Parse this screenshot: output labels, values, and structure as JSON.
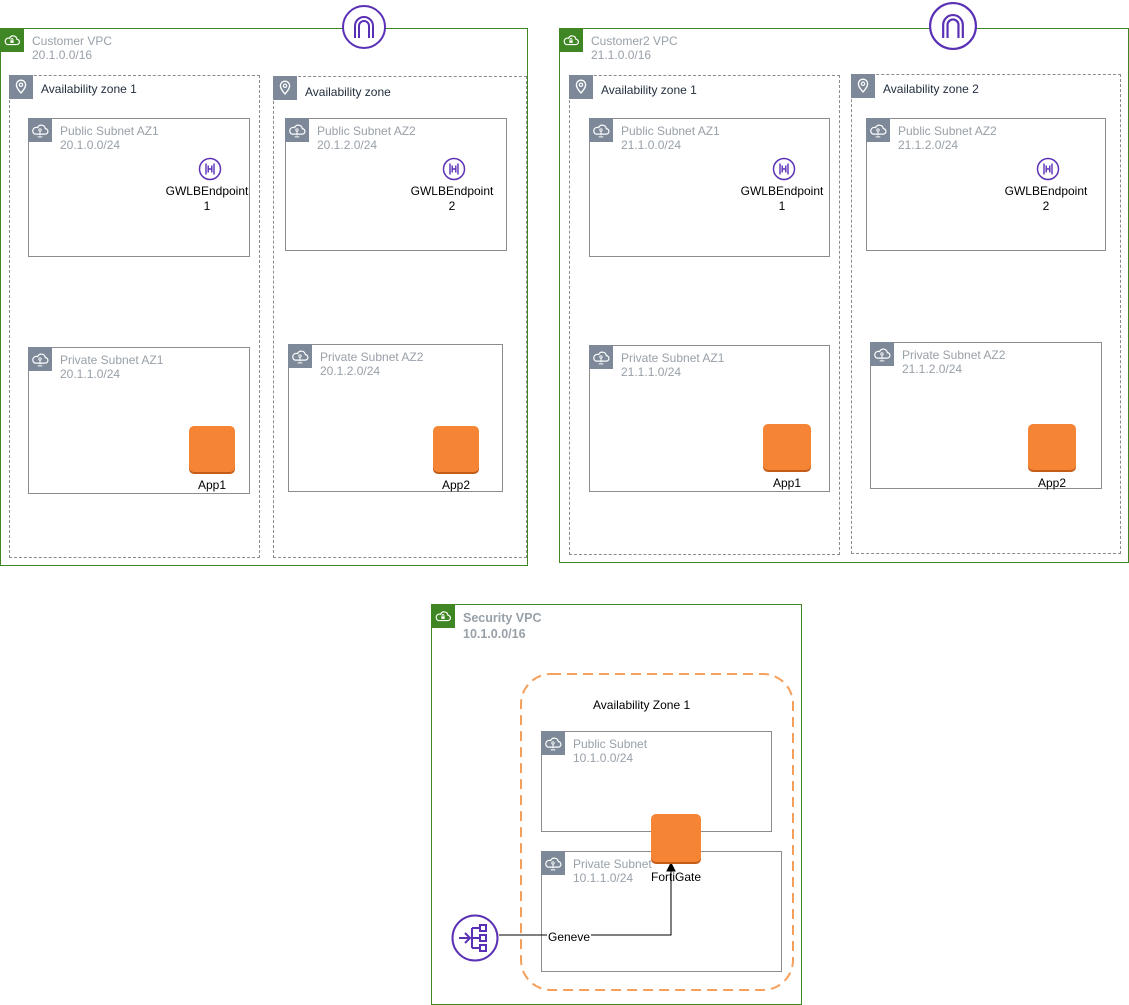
{
  "customer_vpc": {
    "name": "Customer VPC",
    "cidr": "20.1.0.0/16",
    "az1": {
      "label": "Availability zone 1",
      "public_subnet": {
        "name": "Public Subnet AZ1",
        "cidr": "20.1.0.0/24",
        "endpoint_label": "GWLBEndpoint",
        "endpoint_num": "1"
      },
      "private_subnet": {
        "name": "Private Subnet AZ1",
        "cidr": "20.1.1.0/24",
        "app": "App1"
      }
    },
    "az2": {
      "label": "Availability zone",
      "public_subnet": {
        "name": "Public Subnet AZ2",
        "cidr": "20.1.2.0/24",
        "endpoint_label": "GWLBEndpoint",
        "endpoint_num": "2"
      },
      "private_subnet": {
        "name": "Private Subnet AZ2",
        "cidr": "20.1.2.0/24",
        "app": "App2"
      }
    }
  },
  "customer2_vpc": {
    "name": "Customer2 VPC",
    "cidr": "21.1.0.0/16",
    "az1": {
      "label": "Availability zone 1",
      "public_subnet": {
        "name": "Public Subnet AZ1",
        "cidr": "21.1.0.0/24",
        "endpoint_label": "GWLBEndpoint",
        "endpoint_num": "1"
      },
      "private_subnet": {
        "name": "Private Subnet AZ1",
        "cidr": "21.1.1.0/24",
        "app": "App1"
      }
    },
    "az2": {
      "label": "Availability zone 2",
      "public_subnet": {
        "name": "Public Subnet AZ2",
        "cidr": "21.1.2.0/24",
        "endpoint_label": "GWLBEndpoint",
        "endpoint_num": "2"
      },
      "private_subnet": {
        "name": "Private Subnet AZ2",
        "cidr": "21.1.2.0/24",
        "app": "App2"
      }
    }
  },
  "security_vpc": {
    "name": "Security VPC",
    "cidr": "10.1.0.0/16",
    "az_label": "Availability Zone 1",
    "public_subnet": {
      "name": "Public Subnet",
      "cidr": "10.1.0.0/24"
    },
    "private_subnet": {
      "name": "Private Subnet",
      "cidr": "10.1.1.0/24"
    },
    "firewall": "FortiGate",
    "connection_label": "Geneve"
  },
  "colors": {
    "vpc_border": "#3f8624",
    "aws_purple": "#5a30b5",
    "ec2_orange": "#f58534",
    "az_orange_dash": "#f5a05c",
    "subnet_grey": "#7d8998"
  },
  "icons": [
    "vpc-cloud-lock-icon",
    "availability-zone-pin-icon",
    "subnet-cloud-icon",
    "internet-gateway-icon",
    "gwlb-endpoint-icon",
    "gateway-load-balancer-icon",
    "ec2-instance-icon"
  ]
}
